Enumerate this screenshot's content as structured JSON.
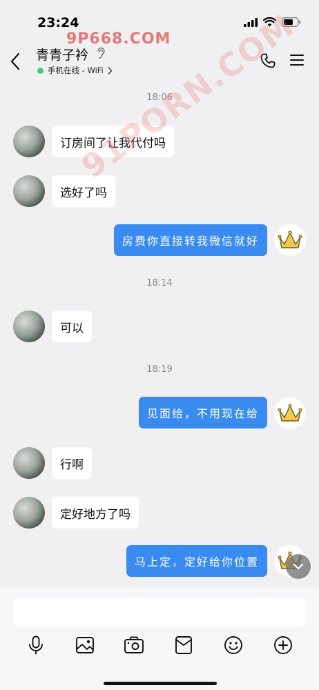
{
  "status_bar": {
    "time": "23:24"
  },
  "watermarks": {
    "top": "9P668.COM",
    "diagonal": "91PORN.COM"
  },
  "header": {
    "title": "青青子衿",
    "status": "手机在线 - WiFi",
    "status_color": "#3ecf6e"
  },
  "messages": [
    {
      "type": "timestamp",
      "text": "18:06"
    },
    {
      "type": "in",
      "text": "订房间了让我代付吗"
    },
    {
      "type": "in",
      "text": "选好了吗"
    },
    {
      "type": "out",
      "text": "房费你直接转我微信就好"
    },
    {
      "type": "timestamp",
      "text": "18:14"
    },
    {
      "type": "in",
      "text": "可以"
    },
    {
      "type": "timestamp",
      "text": "18:19"
    },
    {
      "type": "out",
      "text": "见面给，不用现在给"
    },
    {
      "type": "in",
      "text": "行啊"
    },
    {
      "type": "in",
      "text": "定好地方了吗"
    },
    {
      "type": "out",
      "text": "马上定，定好给你位置"
    }
  ],
  "colors": {
    "outgoing_bubble": "#3a8bf0",
    "incoming_bubble": "#ffffff",
    "background": "#f0f0f2"
  },
  "toolbar": [
    "microphone-icon",
    "image-icon",
    "camera-icon",
    "red-packet-icon",
    "emoji-icon",
    "plus-icon"
  ]
}
